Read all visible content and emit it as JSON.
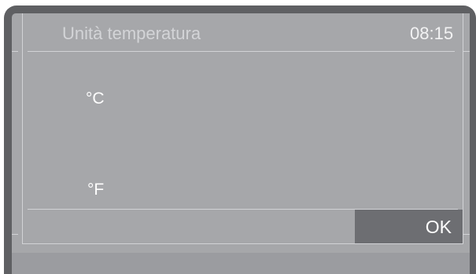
{
  "screen": {
    "title": "Unità temperatura",
    "clock": "08:15"
  },
  "options": [
    {
      "label": "°C"
    },
    {
      "label": "°F"
    }
  ],
  "footer": {
    "ok_label": "OK"
  },
  "colors": {
    "bezel": "#5f6063",
    "screen": "#a6a7aa",
    "ok_button": "#6d6e72",
    "frame_lines": "#d2d3d6",
    "text": "#ffffff"
  }
}
